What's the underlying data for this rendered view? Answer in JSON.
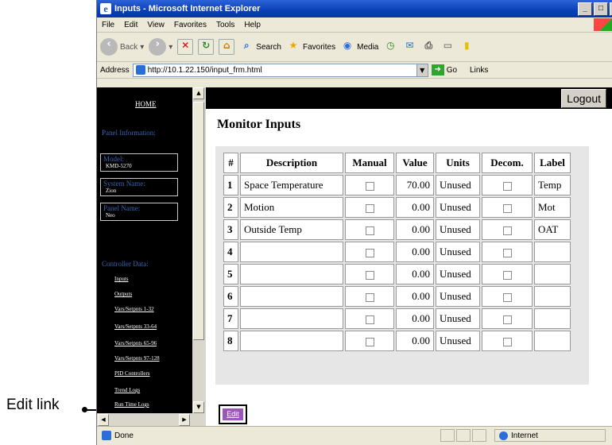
{
  "annotation": {
    "callout_label": "Edit link"
  },
  "window": {
    "title": "Inputs - Microsoft Internet Explorer"
  },
  "menubar": [
    "File",
    "Edit",
    "View",
    "Favorites",
    "Tools",
    "Help"
  ],
  "toolbar": {
    "back": "Back",
    "search": "Search",
    "favorites": "Favorites",
    "media": "Media"
  },
  "addressbar": {
    "label": "Address",
    "url": "http://10.1.22.150/input_frm.html",
    "go": "Go",
    "links": "Links"
  },
  "sidebar": {
    "home": "HOME",
    "panel_info_heading": "Panel Information:",
    "info": [
      {
        "label": "Model:",
        "value": "KMD-5270"
      },
      {
        "label": "System Name:",
        "value": "Zion"
      },
      {
        "label": "Panel Name:",
        "value": "Neo"
      }
    ],
    "controller_heading": "Controller Data:",
    "links": [
      "Inputs",
      "Outputs",
      "Vars/Setpnts 1-32",
      "Vars/Setpnts 33-64",
      "Vars/Setpnts 65-96",
      "Vars/Setpnts 97-128",
      "PID Controllers",
      "Trend Logs",
      "Run Time Logs"
    ]
  },
  "main": {
    "logout": "Logout",
    "title": "Monitor Inputs",
    "edit": "Edit"
  },
  "table": {
    "headers": [
      "#",
      "Description",
      "Manual",
      "Value",
      "Units",
      "Decom.",
      "Label"
    ],
    "rows": [
      {
        "num": "1",
        "description": "Space Temperature",
        "value": "70.00",
        "units": "Unused",
        "label": "Temp"
      },
      {
        "num": "2",
        "description": "Motion",
        "value": "0.00",
        "units": "Unused",
        "label": "Mot"
      },
      {
        "num": "3",
        "description": "Outside Temp",
        "value": "0.00",
        "units": "Unused",
        "label": "OAT"
      },
      {
        "num": "4",
        "description": "",
        "value": "0.00",
        "units": "Unused",
        "label": ""
      },
      {
        "num": "5",
        "description": "",
        "value": "0.00",
        "units": "Unused",
        "label": ""
      },
      {
        "num": "6",
        "description": "",
        "value": "0.00",
        "units": "Unused",
        "label": ""
      },
      {
        "num": "7",
        "description": "",
        "value": "0.00",
        "units": "Unused",
        "label": ""
      },
      {
        "num": "8",
        "description": "",
        "value": "0.00",
        "units": "Unused",
        "label": ""
      }
    ]
  },
  "statusbar": {
    "status": "Done",
    "zone": "Internet"
  }
}
